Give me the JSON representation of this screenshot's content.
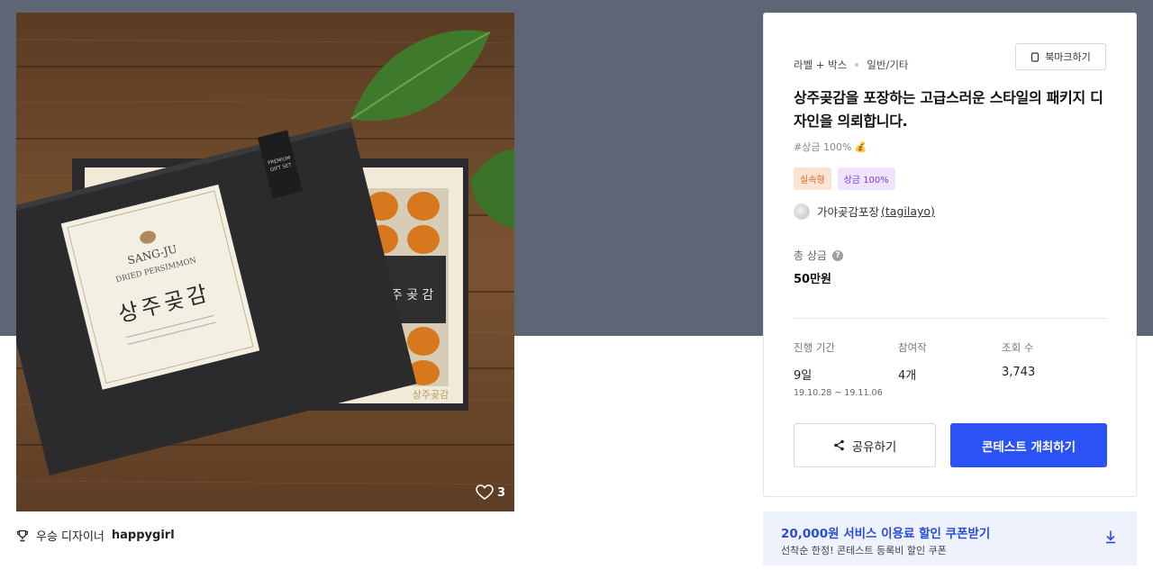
{
  "product": {
    "box_brand": "SANG-JU",
    "box_sub": "DRIED PERSIMMON",
    "box_korean": "상주곶감",
    "box_ribbon": "PREMIUM GIFT SET",
    "likes": "3"
  },
  "winner": {
    "label": "우승 디자이너",
    "name": "happygirl"
  },
  "card": {
    "category": "라벨 + 박스",
    "subcategory": "일반/기타",
    "bookmark_label": "북마크하기",
    "title": "상주곶감을 포장하는 고급스러운 스타일의 패키지 디자인을 의뢰합니다.",
    "tagline": "#상금 100% 💰",
    "badges": [
      "실속형",
      "상금 100%"
    ],
    "client": "가야곶감포장",
    "client_handle": "(tagilayo)",
    "prize_label": "총 상금",
    "prize_value": "50만원",
    "stats": {
      "period_label": "진행 기간",
      "period_value": "9일",
      "period_dates": "19.10.28 ~ 19.11.06",
      "entries_label": "참여작",
      "entries_value": "4개",
      "views_label": "조회 수",
      "views_value": "3,743"
    },
    "share_label": "공유하기",
    "host_label": "콘테스트 개최하기"
  },
  "coupon": {
    "title": "20,000원 서비스 이용료 할인 쿠폰받기",
    "subtitle": "선착순 한정! 콘테스트 등록비 할인 쿠폰"
  },
  "colors": {
    "hero_bg": "#5e6574",
    "primary": "#2b52f5",
    "coupon_bg": "#eef2fd"
  }
}
